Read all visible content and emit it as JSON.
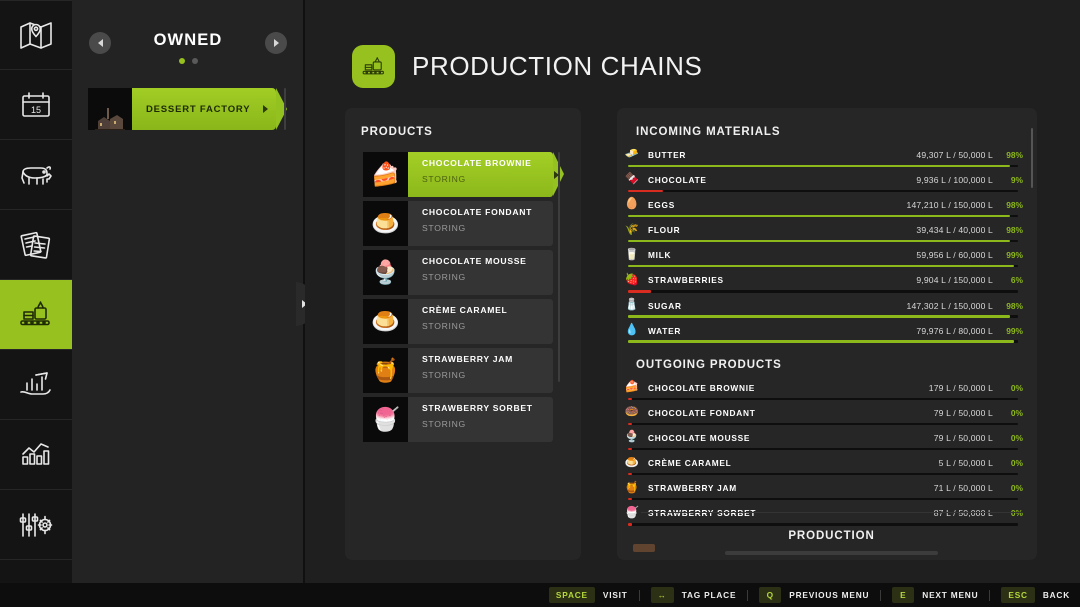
{
  "sidebar": {
    "items": [
      {
        "icon": "map-icon",
        "label": "Map",
        "active": false
      },
      {
        "icon": "calendar-icon",
        "label": "Calendar",
        "active": false,
        "day": "15"
      },
      {
        "icon": "animals-icon",
        "label": "Animals",
        "active": false
      },
      {
        "icon": "contracts-icon",
        "label": "Contracts",
        "active": false
      },
      {
        "icon": "production-icon",
        "label": "Production Chains",
        "active": true
      },
      {
        "icon": "finances-icon",
        "label": "Finances",
        "active": false
      },
      {
        "icon": "statistics-icon",
        "label": "Statistics",
        "active": false
      },
      {
        "icon": "settings-icon",
        "label": "Settings",
        "active": false
      }
    ]
  },
  "owned": {
    "title": "OWNED",
    "prev_label": "Previous",
    "next_label": "Next",
    "page_dots": 2,
    "active_dot": 0,
    "entries": [
      {
        "name": "DESSERT FACTORY",
        "selected": true,
        "thumb": "🏭"
      }
    ]
  },
  "header": {
    "title": "PRODUCTION CHAINS",
    "icon": "production-icon"
  },
  "products": {
    "title": "PRODUCTS",
    "items": [
      {
        "name": "CHOCOLATE BROWNIE",
        "status": "STORING",
        "thumb": "🍰",
        "selected": true
      },
      {
        "name": "CHOCOLATE FONDANT",
        "status": "STORING",
        "thumb": "🍮",
        "selected": false
      },
      {
        "name": "CHOCOLATE MOUSSE",
        "status": "STORING",
        "thumb": "🍨",
        "selected": false
      },
      {
        "name": "CRÈME CARAMEL",
        "status": "STORING",
        "thumb": "🍮",
        "selected": false
      },
      {
        "name": "STRAWBERRY JAM",
        "status": "STORING",
        "thumb": "🍯",
        "selected": false
      },
      {
        "name": "STRAWBERRY SORBET",
        "status": "STORING",
        "thumb": "🍧",
        "selected": false
      }
    ]
  },
  "incoming": {
    "title": "INCOMING MATERIALS",
    "items": [
      {
        "name": "BUTTER",
        "icon": "🧈",
        "amount": "49,307 L / 50,000 L",
        "percent": "98%",
        "fill": 98,
        "color": "#8cb81b"
      },
      {
        "name": "CHOCOLATE",
        "icon": "🍫",
        "amount": "9,936 L / 100,000 L",
        "percent": "9%",
        "fill": 9,
        "color": "#d92c20"
      },
      {
        "name": "EGGS",
        "icon": "🥚",
        "amount": "147,210 L / 150,000 L",
        "percent": "98%",
        "fill": 98,
        "color": "#8cb81b"
      },
      {
        "name": "FLOUR",
        "icon": "🌾",
        "amount": "39,434 L / 40,000 L",
        "percent": "98%",
        "fill": 98,
        "color": "#8cb81b"
      },
      {
        "name": "MILK",
        "icon": "🥛",
        "amount": "59,956 L / 60,000 L",
        "percent": "99%",
        "fill": 99,
        "color": "#8cb81b"
      },
      {
        "name": "STRAWBERRIES",
        "icon": "🍓",
        "amount": "9,904 L / 150,000 L",
        "percent": "6%",
        "fill": 6,
        "color": "#d92c20"
      },
      {
        "name": "SUGAR",
        "icon": "🧂",
        "amount": "147,302 L / 150,000 L",
        "percent": "98%",
        "fill": 98,
        "color": "#8cb81b"
      },
      {
        "name": "WATER",
        "icon": "💧",
        "amount": "79,976 L / 80,000 L",
        "percent": "99%",
        "fill": 99,
        "color": "#8cb81b"
      }
    ]
  },
  "outgoing": {
    "title": "OUTGOING PRODUCTS",
    "items": [
      {
        "name": "CHOCOLATE BROWNIE",
        "icon": "🍰",
        "amount": "179 L / 50,000 L",
        "percent": "0%",
        "fill": 1,
        "color": "#d92c20"
      },
      {
        "name": "CHOCOLATE FONDANT",
        "icon": "🍩",
        "amount": "79 L / 50,000 L",
        "percent": "0%",
        "fill": 1,
        "color": "#d92c20"
      },
      {
        "name": "CHOCOLATE MOUSSE",
        "icon": "🍨",
        "amount": "79 L / 50,000 L",
        "percent": "0%",
        "fill": 1,
        "color": "#d92c20"
      },
      {
        "name": "CRÈME CARAMEL",
        "icon": "🍮",
        "amount": "5 L / 50,000 L",
        "percent": "0%",
        "fill": 1,
        "color": "#d92c20"
      },
      {
        "name": "STRAWBERRY JAM",
        "icon": "🍯",
        "amount": "71 L / 50,000 L",
        "percent": "0%",
        "fill": 1,
        "color": "#d92c20"
      },
      {
        "name": "STRAWBERRY SORBET",
        "icon": "🍧",
        "amount": "87 L / 50,000 L",
        "percent": "0%",
        "fill": 1,
        "color": "#d92c20"
      }
    ]
  },
  "production": {
    "title": "PRODUCTION"
  },
  "bottom_bar": {
    "hints": [
      {
        "key": "SPACE",
        "label": "VISIT"
      },
      {
        "key": "↔",
        "label": "TAG PLACE"
      },
      {
        "key": "Q",
        "label": "PREVIOUS MENU"
      },
      {
        "key": "E",
        "label": "NEXT MENU"
      },
      {
        "key": "ESC",
        "label": "BACK"
      }
    ]
  },
  "colors": {
    "accent": "#96c11e",
    "bar_full": "#8cb81b",
    "bar_low": "#d92c20",
    "panel": "#262626",
    "background": "#1f1f1f"
  }
}
